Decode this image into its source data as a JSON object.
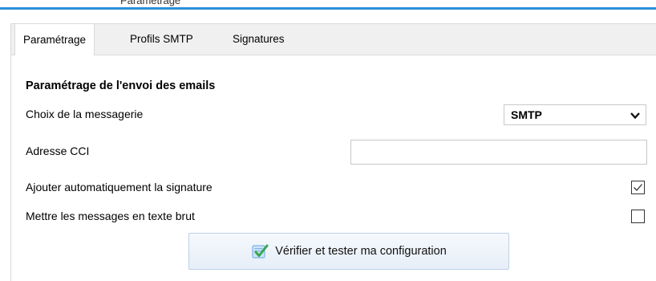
{
  "window": {
    "title": "Paramétrage"
  },
  "tabs": [
    {
      "label": "Paramétrage",
      "active": true
    },
    {
      "label": "Profils SMTP",
      "active": false
    },
    {
      "label": "Signatures",
      "active": false
    }
  ],
  "section": {
    "heading": "Paramétrage de l'envoi des emails"
  },
  "fields": {
    "messaging_label": "Choix de la messagerie",
    "messaging_value": "SMTP",
    "cci_label": "Adresse CCI",
    "cci_value": "",
    "signature_label": "Ajouter automatiquement la signature",
    "signature_checked": true,
    "plaintext_label": "Mettre les messages en texte brut",
    "plaintext_checked": false
  },
  "actions": {
    "verify_label": "Vérifier et tester ma configuration"
  },
  "icons": {
    "verify": "check-document-icon",
    "dropdown": "chevron-down-icon",
    "checkmark": "checkmark-icon"
  },
  "colors": {
    "accent_bar": "#2b8fd9",
    "tab_strip": "#f0f0f0",
    "icon_green": "#3aa64a",
    "icon_blue": "#7bb4e8"
  }
}
